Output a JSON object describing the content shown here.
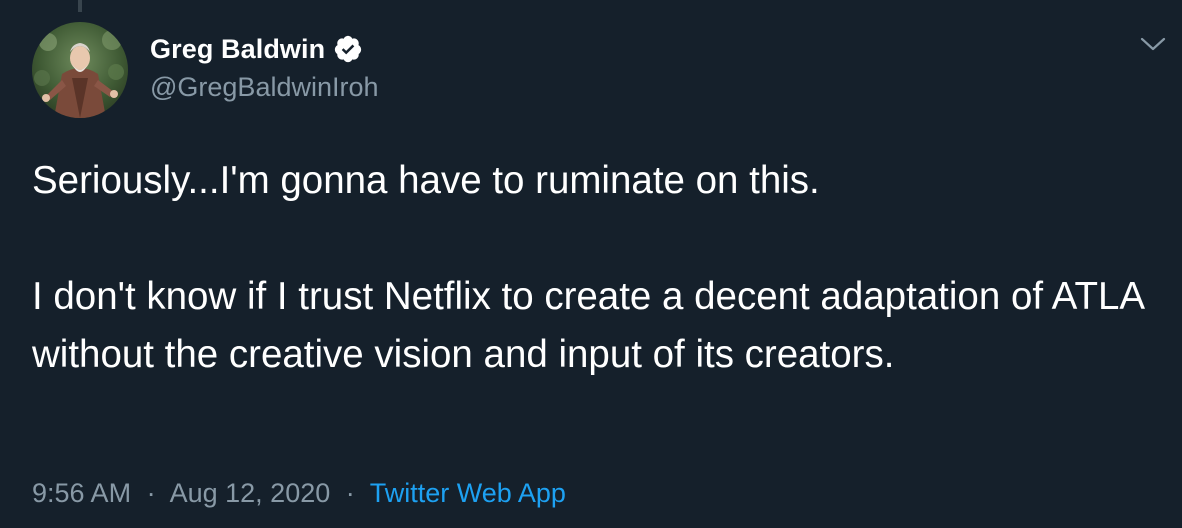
{
  "author": {
    "display_name": "Greg Baldwin",
    "handle": "@GregBaldwinIroh",
    "verified": true,
    "avatar_icon": "profile-photo"
  },
  "tweet": {
    "paragraphs": [
      "Seriously...I'm gonna have to ruminate on this.",
      "I don't know if I trust Netflix to create a decent adaptation of ATLA without the creative vision and input of its creators."
    ]
  },
  "meta": {
    "time": "9:56 AM",
    "separator": "·",
    "date": "Aug 12, 2020",
    "source": "Twitter Web App"
  },
  "icons": {
    "verified": "verified-badge-icon",
    "menu": "chevron-down-icon"
  },
  "colors": {
    "background": "#15202b",
    "text": "#ffffff",
    "secondary_text": "#8899a6",
    "accent": "#1da1f2",
    "verified_badge": "#ffffff"
  }
}
